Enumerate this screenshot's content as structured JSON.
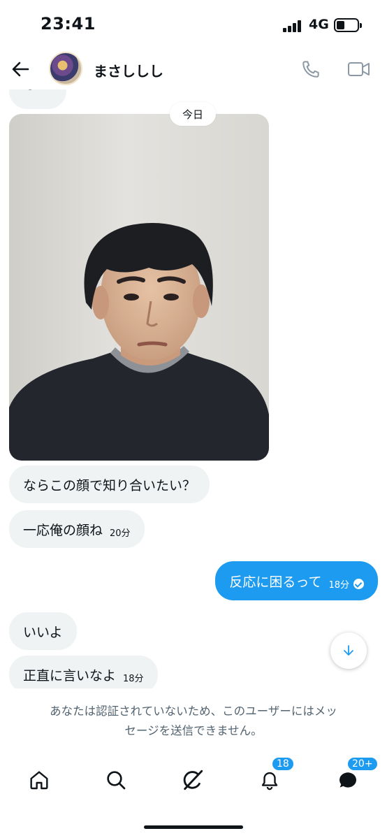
{
  "status_bar": {
    "time": "23:41",
    "network": "4G",
    "battery_level": 0.3
  },
  "header": {
    "name": "まさししし"
  },
  "chat": {
    "cut_message": "ひと",
    "date_divider": "今日",
    "messages": [
      {
        "direction": "in",
        "text": "ならこの顔で知り合いたい？",
        "time": ""
      },
      {
        "direction": "in",
        "text": "一応俺の顔ね",
        "time": "20分"
      },
      {
        "direction": "out",
        "text": "反応に困るって",
        "time": "18分"
      },
      {
        "direction": "in",
        "text": "いいよ",
        "time": ""
      },
      {
        "direction": "in",
        "text": "正直に言いなよ",
        "time": "18分"
      }
    ]
  },
  "notice": {
    "line1": "あなたは認証されていないため、このユーザーにはメッ",
    "line2": "セージを送信できません。"
  },
  "nav": {
    "items": [
      {
        "icon": "home-icon"
      },
      {
        "icon": "search-icon"
      },
      {
        "icon": "grok-icon"
      },
      {
        "icon": "bell-icon",
        "badge": "18"
      },
      {
        "icon": "messages-icon",
        "badge": "20+"
      }
    ]
  },
  "colors": {
    "accent": "#1d9bf0",
    "bubble_in": "#eff3f4",
    "muted": "#536471"
  }
}
